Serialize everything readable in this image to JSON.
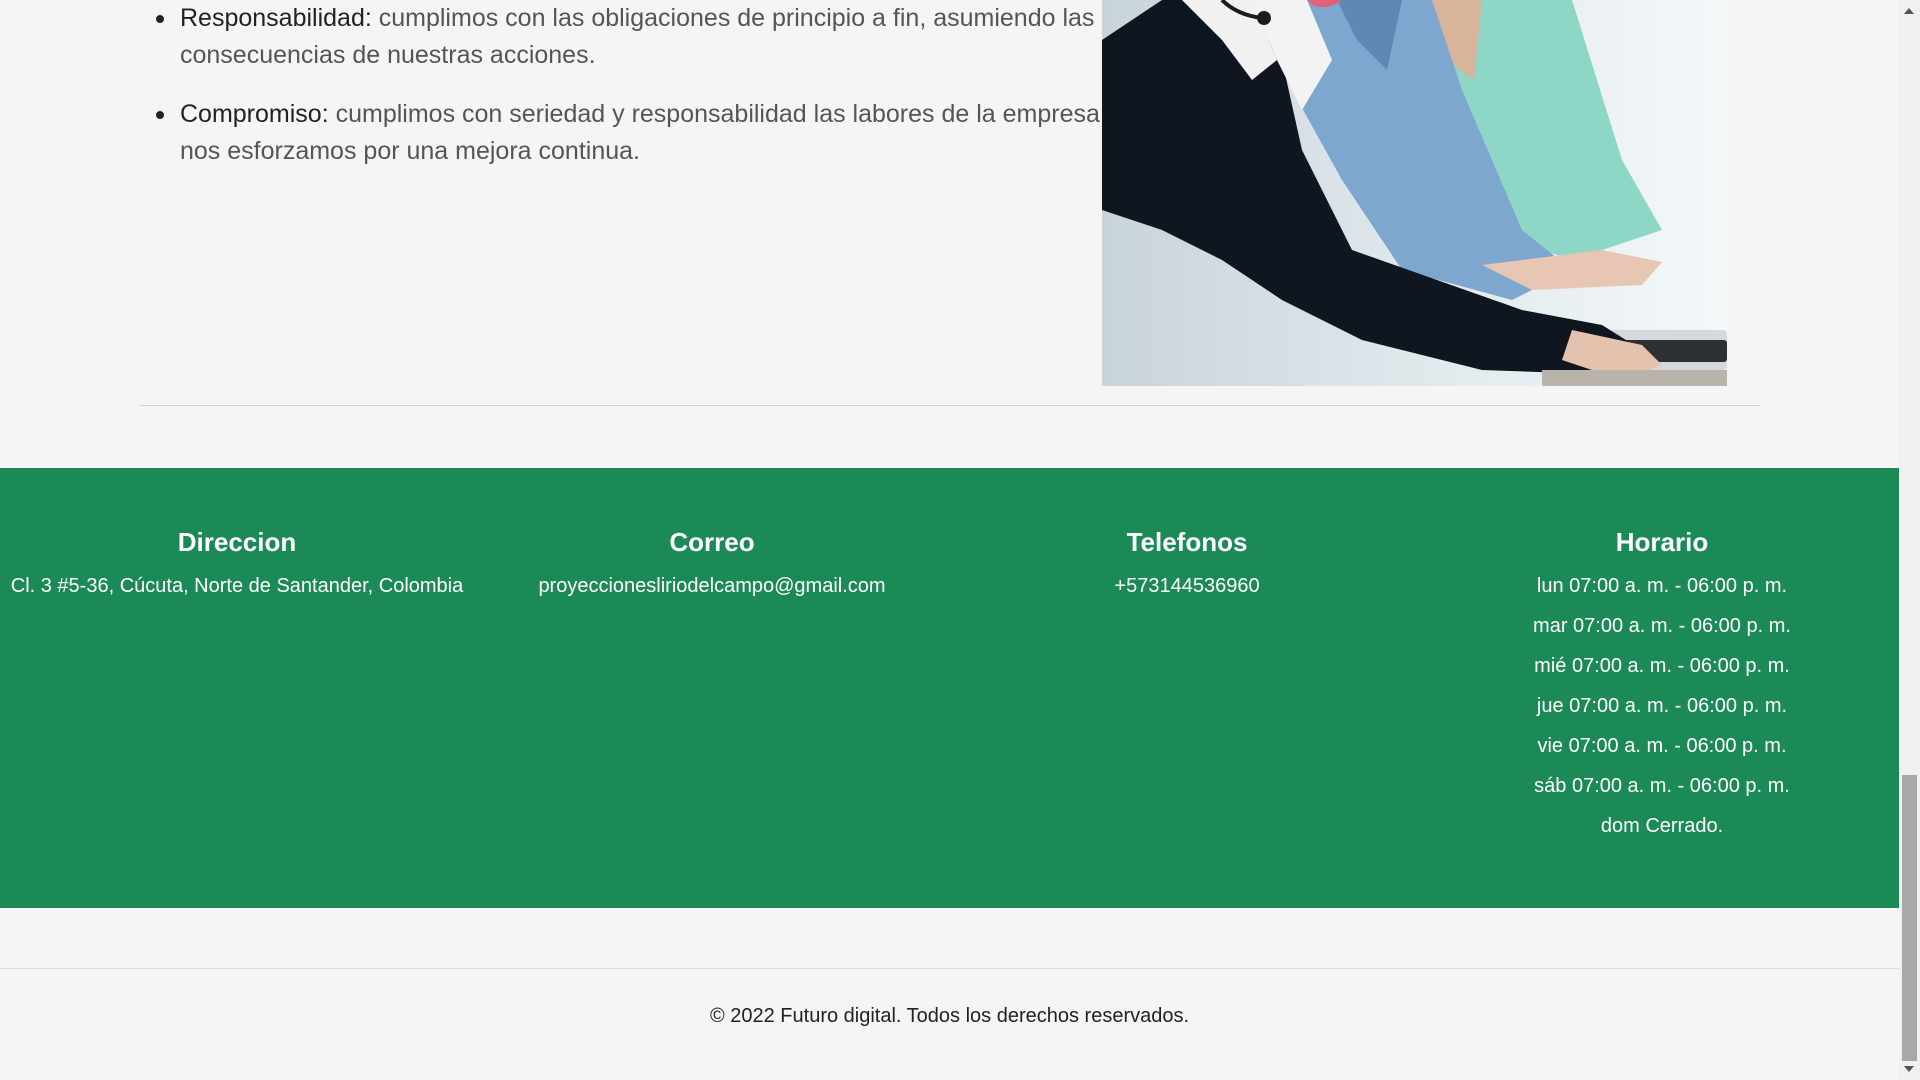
{
  "values": [
    {
      "term": "Responsabilidad:",
      "text": "cumplimos con las obligaciones de principio a fin, asumiendo las consecuencias de nuestras acciones."
    },
    {
      "term": "Compromiso:",
      "text": "cumplimos con seriedad y responsabilidad las labores de la empresa y nos esforzamos por una mejora continua."
    }
  ],
  "footer": {
    "address": {
      "title": "Direccion",
      "value": "Cl. 3 #5-36, Cúcuta, Norte de Santander, Colombia"
    },
    "email": {
      "title": "Correo",
      "value": "proyeccionesliriodelcampo@gmail.com"
    },
    "phones": {
      "title": "Telefonos",
      "value": "+573144536960"
    },
    "schedule": {
      "title": "Horario",
      "days": [
        "lun 07:00 a. m. - 06:00 p. m.",
        "mar 07:00 a. m. - 06:00 p. m.",
        "mié 07:00 a. m. - 06:00 p. m.",
        "jue 07:00 a. m. - 06:00 p. m.",
        "vie 07:00 a. m. - 06:00 p. m.",
        "sáb 07:00 a. m. - 06:00 p. m.",
        "dom Cerrado."
      ]
    }
  },
  "copyright": "© 2022 Futuro digital. Todos los derechos reservados.",
  "colors": {
    "footer_bg": "#1b8a57",
    "page_bg": "#f5f5f5"
  }
}
